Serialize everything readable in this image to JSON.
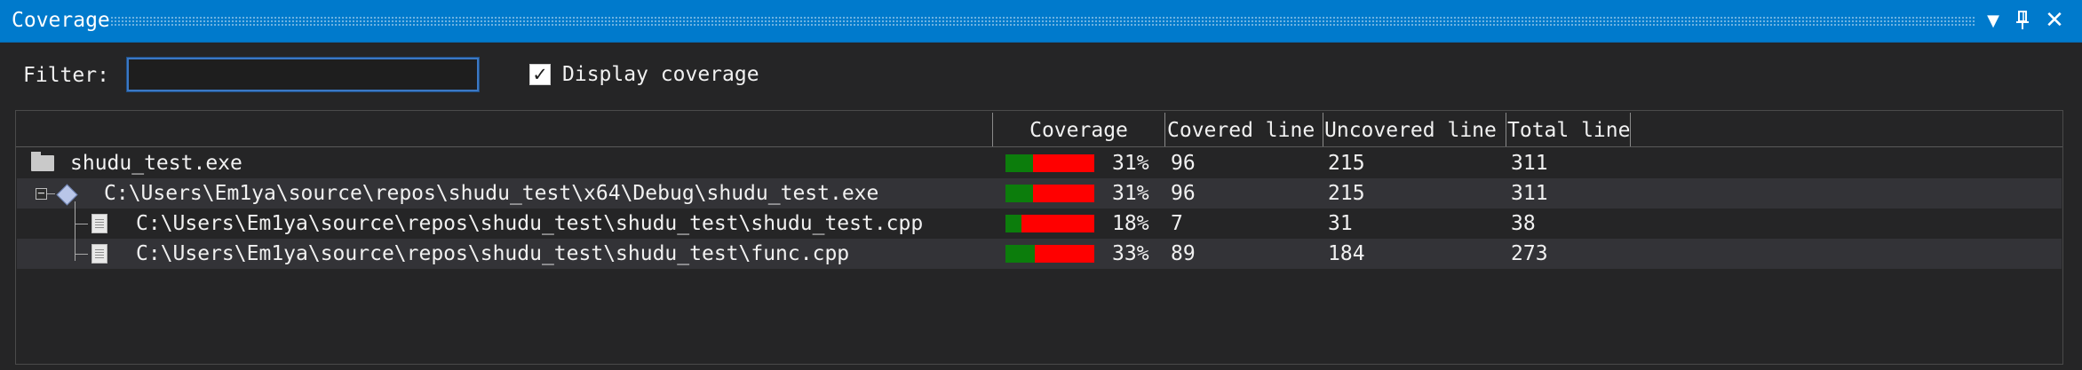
{
  "window": {
    "title": "Coverage",
    "dropdown_icon": "dropdown-arrow-icon",
    "pin_icon": "pin-icon",
    "close_icon": "close-icon"
  },
  "toolbar": {
    "filter_label": "Filter:",
    "filter_value": "",
    "display_coverage_label": "Display coverage",
    "display_coverage_checked": true
  },
  "table": {
    "columns": [
      "Coverage",
      "Covered line",
      "Uncovered line",
      "Total line"
    ],
    "rows": [
      {
        "name": "shudu_test.exe",
        "icon": "folder-icon",
        "coverage_pct": "31%",
        "coverage_fraction": 0.31,
        "covered": "96",
        "uncovered": "215",
        "total": "311"
      },
      {
        "name": "C:\\Users\\Em1ya\\source\\repos\\shudu_test\\x64\\Debug\\shudu_test.exe",
        "icon": "module-icon",
        "expanded": true,
        "coverage_pct": "31%",
        "coverage_fraction": 0.31,
        "covered": "96",
        "uncovered": "215",
        "total": "311"
      },
      {
        "name": "C:\\Users\\Em1ya\\source\\repos\\shudu_test\\shudu_test\\shudu_test.cpp",
        "icon": "source-file-icon",
        "coverage_pct": "18%",
        "coverage_fraction": 0.18,
        "covered": "7",
        "uncovered": "31",
        "total": "38"
      },
      {
        "name": "C:\\Users\\Em1ya\\source\\repos\\shudu_test\\shudu_test\\func.cpp",
        "icon": "source-file-icon",
        "coverage_pct": "33%",
        "coverage_fraction": 0.33,
        "covered": "89",
        "uncovered": "184",
        "total": "273"
      }
    ]
  },
  "colors": {
    "titlebar": "#007acc",
    "covered": "#0c7d0c",
    "uncovered": "#ff0000",
    "background": "#252526"
  }
}
